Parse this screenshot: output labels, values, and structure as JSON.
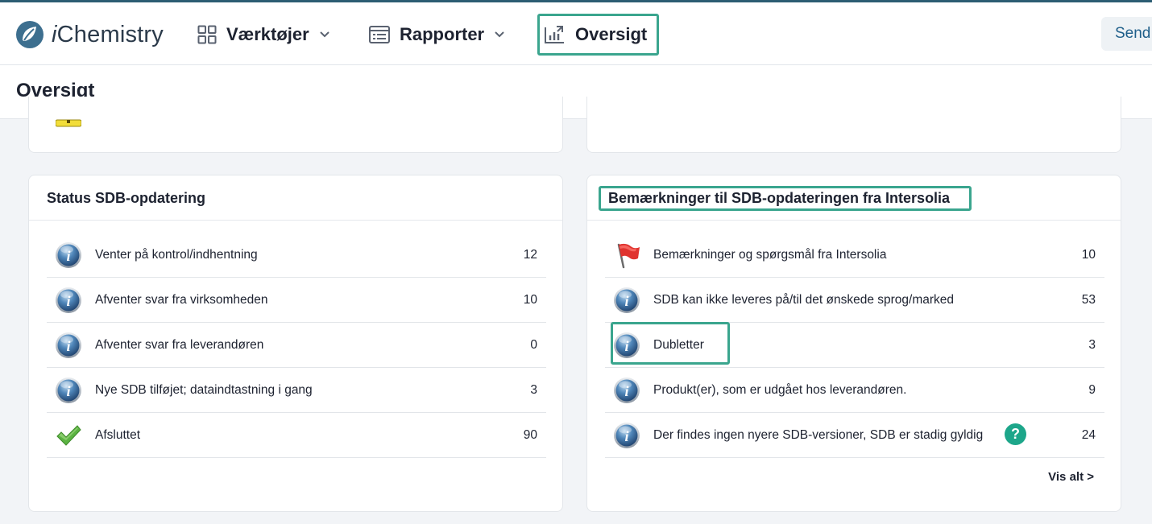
{
  "app": {
    "logo_prefix": "i",
    "logo_name": "Chemistry"
  },
  "nav": {
    "tools": "Værktøjer",
    "reports": "Rapporter",
    "overview": "Oversigt",
    "send": "Send"
  },
  "page": {
    "title": "Oversigt"
  },
  "status_card": {
    "title": "Status SDB-opdatering",
    "rows": [
      {
        "label": "Venter på kontrol/indhentning",
        "count": "12",
        "icon": "info-icon"
      },
      {
        "label": "Afventer svar fra virksomheden",
        "count": "10",
        "icon": "info-icon"
      },
      {
        "label": "Afventer svar fra leverandøren",
        "count": "0",
        "icon": "info-icon"
      },
      {
        "label": "Nye SDB tilføjet; dataindtastning i gang",
        "count": "3",
        "icon": "info-icon"
      },
      {
        "label": "Afsluttet",
        "count": "90",
        "icon": "check-icon"
      }
    ]
  },
  "remarks_card": {
    "title": "Bemærkninger til SDB-opdateringen fra Intersolia",
    "rows": [
      {
        "label": "Bemærkninger og spørgsmål fra Intersolia",
        "count": "10",
        "icon": "red-flag-icon"
      },
      {
        "label": "SDB kan ikke leveres på/til det ønskede sprog/marked",
        "count": "53",
        "icon": "info-icon"
      },
      {
        "label": "Dubletter",
        "count": "3",
        "icon": "info-icon"
      },
      {
        "label": "Produkt(er), som er udgået hos leverandøren.",
        "count": "9",
        "icon": "info-icon"
      },
      {
        "label": "Der findes ingen nyere SDB-versioner, SDB er stadig gyldig",
        "count": "24",
        "icon": "info-icon",
        "help": "?"
      }
    ],
    "view_all": "Vis alt >"
  },
  "colors": {
    "accent": "#3aa58e",
    "help": "#1da68a",
    "topline": "#2c5d73"
  }
}
